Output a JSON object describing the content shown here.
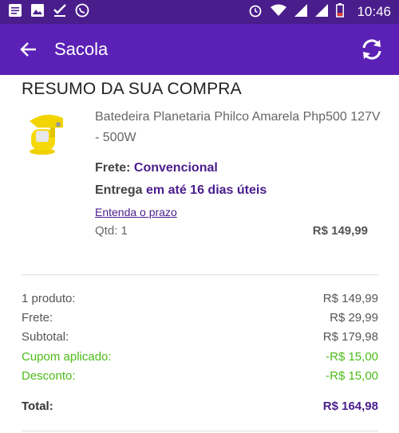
{
  "status_bar": {
    "time": "10:46",
    "left_icons": [
      "notes-icon",
      "image-icon",
      "check-icon",
      "whatsapp-icon"
    ],
    "right_icons": [
      "alarm-icon",
      "wifi-icon",
      "signal-icon",
      "signal-icon",
      "battery-icon"
    ]
  },
  "app_bar": {
    "title": "Sacola",
    "back_icon": "arrow-left-icon",
    "refresh_icon": "refresh-icon",
    "bg_color": "#5b21b6"
  },
  "summary": {
    "heading": "RESUMO DA SUA COMPRA",
    "product": {
      "name": "Batedeira Planetaria Philco Amarela Php500 127V - 500W",
      "frete_label": "Frete:",
      "frete_value": "Convencional",
      "entrega_label": "Entrega",
      "entrega_value": "em até 16 dias úteis",
      "prazo_link": "Entenda o prazo",
      "qtd": "Qtd: 1",
      "price": "R$ 149,99"
    },
    "rows": [
      {
        "label": "1 produto:",
        "value": "R$ 149,99"
      },
      {
        "label": "Frete:",
        "value": "R$ 29,99"
      },
      {
        "label": "Subtotal:",
        "value": "R$ 179,98"
      },
      {
        "label": "Cupom aplicado:",
        "value": "-R$ 15,00"
      },
      {
        "label": "Desconto:",
        "value": "-R$ 15,00"
      }
    ],
    "total_label": "Total:",
    "total_value": "R$ 164,98"
  },
  "colors": {
    "accent": "#4a1d8c",
    "discount": "#4cbb17"
  }
}
